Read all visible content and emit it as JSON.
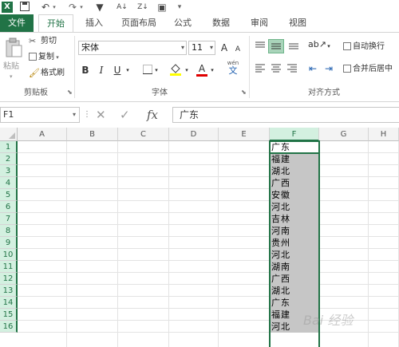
{
  "colors": {
    "accent": "#217346",
    "selection_fill": "#c6c6c6",
    "header_selected": "#d3f0e0"
  },
  "qat": {
    "icons": [
      "excel-logo-icon",
      "save-icon",
      "undo-icon",
      "redo-icon",
      "filter-icon",
      "sort-ascending-icon",
      "sort-descending-icon",
      "dropdown-icon"
    ],
    "app_glyph": "X"
  },
  "tabs": [
    {
      "label": "文件"
    },
    {
      "label": "开始"
    },
    {
      "label": "插入"
    },
    {
      "label": "页面布局"
    },
    {
      "label": "公式"
    },
    {
      "label": "数据"
    },
    {
      "label": "审阅"
    },
    {
      "label": "视图"
    }
  ],
  "ribbon": {
    "clipboard": {
      "paste": "粘贴",
      "cut": "剪切",
      "copy": "复制",
      "format_painter": "格式刷",
      "label": "剪贴板"
    },
    "font": {
      "font_name": "宋体",
      "font_size": "11",
      "grow": "A",
      "shrink": "A",
      "bold": "B",
      "italic": "I",
      "underline": "U",
      "font_color_glyph": "A",
      "phonetic": "wén",
      "phonetic_char": "文",
      "label": "字体"
    },
    "alignment": {
      "wrap_text": "自动换行",
      "merge_center": "合并后居中",
      "label": "对齐方式"
    }
  },
  "formula_bar": {
    "name_box": "F1",
    "fx": "fx",
    "formula": "广东"
  },
  "grid": {
    "columns": [
      "A",
      "B",
      "C",
      "D",
      "E",
      "F",
      "G",
      "H"
    ],
    "selected_column": "F",
    "rows": [
      "1",
      "2",
      "3",
      "4",
      "5",
      "6",
      "7",
      "8",
      "9",
      "10",
      "11",
      "12",
      "13",
      "14",
      "15",
      "16"
    ],
    "column_f_values": [
      "广东",
      "福建",
      "湖北",
      "广西",
      "安徽",
      "河北",
      "吉林",
      "河南",
      "贵州",
      "河北",
      "湖南",
      "广西",
      "湖北",
      "广东",
      "福建",
      "河北"
    ]
  },
  "watermark": "Bai 经验"
}
